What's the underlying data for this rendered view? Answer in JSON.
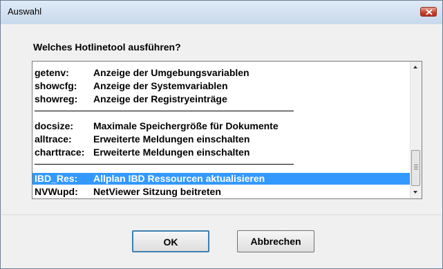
{
  "window": {
    "title": "Auswahl"
  },
  "prompt": "Welches Hotlinetool ausführen?",
  "list": {
    "groups": [
      [
        {
          "code": "getenv:",
          "desc": "Anzeige der Umgebungsvariablen"
        },
        {
          "code": "showcfg:",
          "desc": "Anzeige der Systemvariablen"
        },
        {
          "code": "showreg:",
          "desc": "Anzeige der Registryeinträge"
        }
      ],
      [
        {
          "code": "docsize:",
          "desc": "Maximale Speichergröße für Dokumente"
        },
        {
          "code": "alltrace:",
          "desc": "Erweiterte Meldungen einschalten"
        },
        {
          "code": "charttrace:",
          "desc": "Erweiterte Meldungen einschalten"
        }
      ],
      [
        {
          "code": "IBD_Res:",
          "desc": "Allplan IBD Ressourcen aktualisieren",
          "selected": true
        },
        {
          "code": "NVWupd:",
          "desc": "NetViewer Sitzung beitreten"
        }
      ]
    ]
  },
  "buttons": {
    "ok": "OK",
    "cancel": "Abbrechen"
  },
  "colors": {
    "selection": "#3399ff",
    "close": "#c5412a"
  },
  "icons": {
    "close": "close-icon"
  }
}
